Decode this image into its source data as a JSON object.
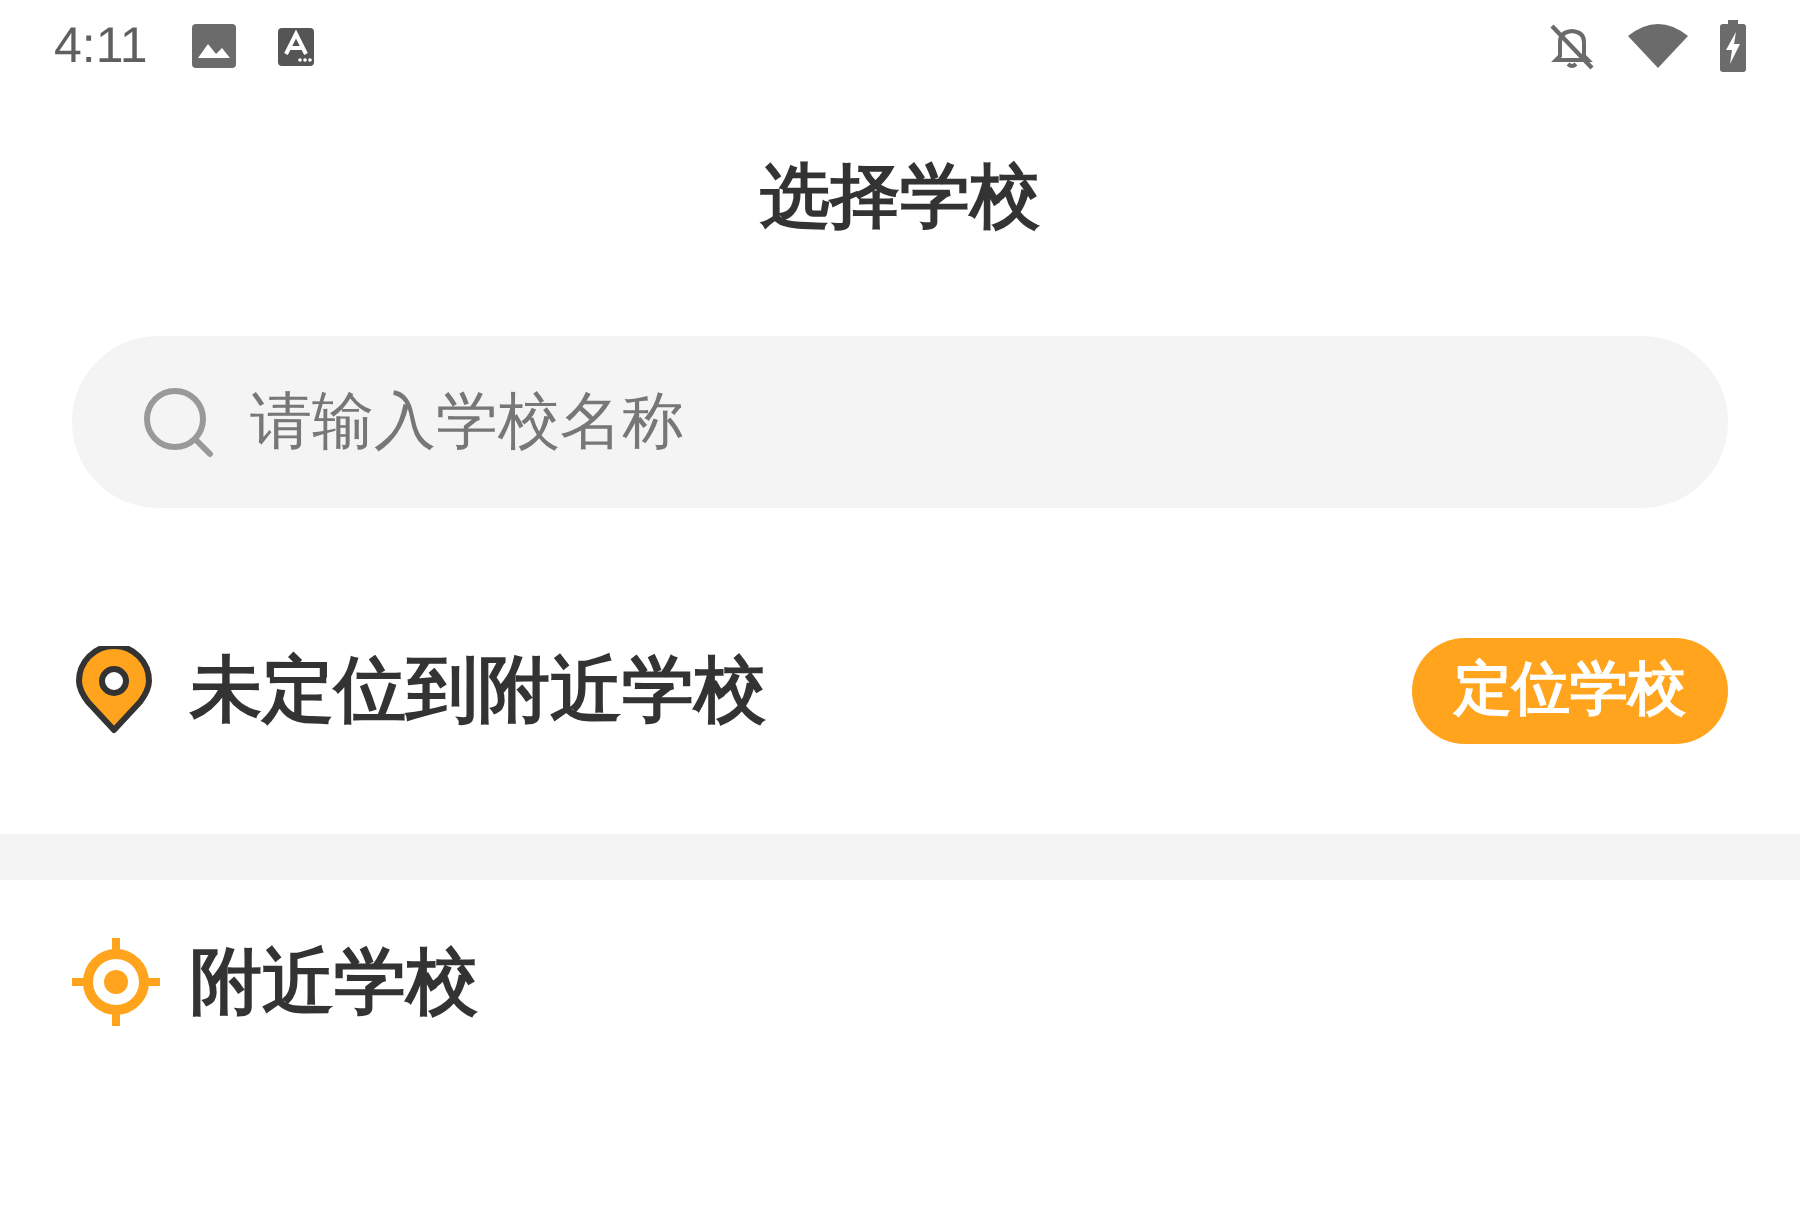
{
  "status_bar": {
    "time": "4:11"
  },
  "header": {
    "title": "选择学校"
  },
  "search": {
    "placeholder": "请输入学校名称"
  },
  "location": {
    "status": "未定位到附近学校",
    "button": "定位学校"
  },
  "nearby": {
    "title": "附近学校"
  }
}
